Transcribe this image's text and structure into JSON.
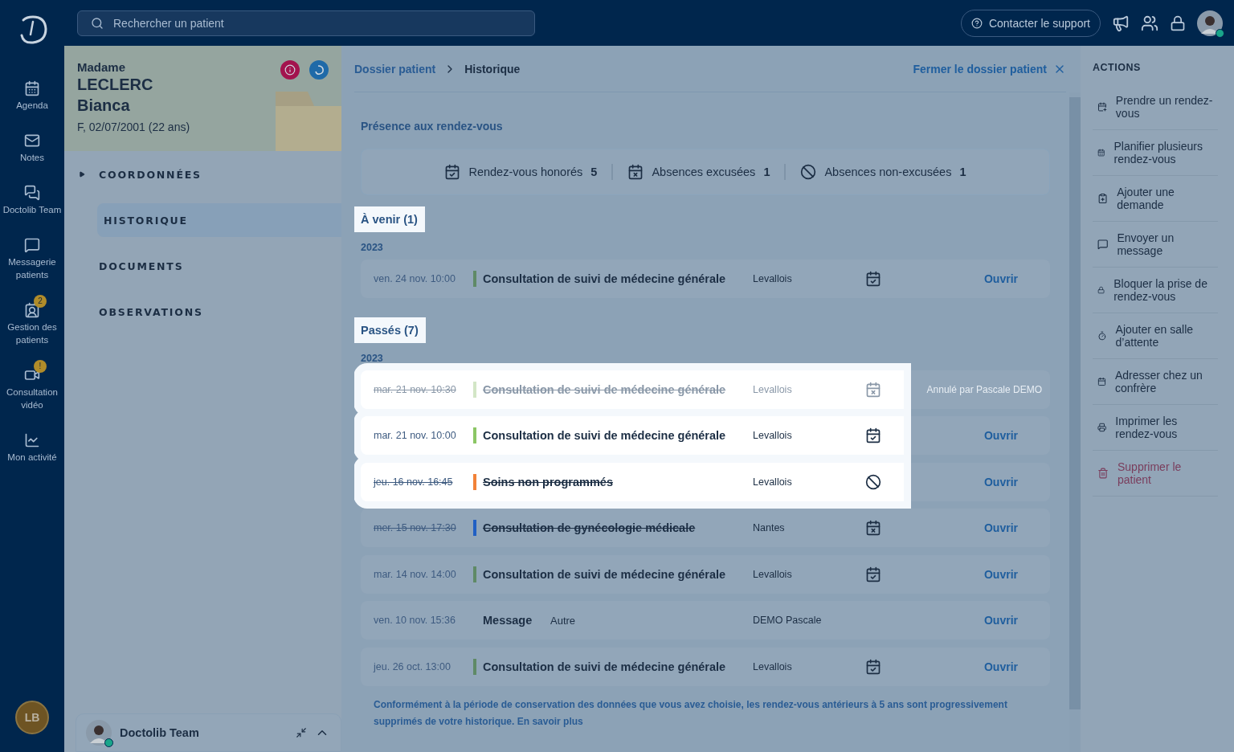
{
  "topbar": {
    "search_placeholder": "Rechercher un patient",
    "support": "Contacter le support"
  },
  "nav": [
    {
      "label": "Agenda"
    },
    {
      "label": "Notes"
    },
    {
      "label": "Doctolib Team"
    },
    {
      "label": "Messagerie patients"
    },
    {
      "label": "Gestion des patients",
      "badge": "2"
    },
    {
      "label": "Consultation vidéo",
      "badge": "!"
    },
    {
      "label": "Mon activité"
    }
  ],
  "user_initials": "LB",
  "patient": {
    "civility": "Madame",
    "last_name": "LECLERC",
    "first_name": "Bianca",
    "details": "F, 02/07/2001 (22 ans)"
  },
  "sections": [
    {
      "label": "COORDONNÉES",
      "expandable": true,
      "selected": false
    },
    {
      "label": "HISTORIQUE",
      "expandable": false,
      "selected": true
    },
    {
      "label": "DOCUMENTS",
      "expandable": false,
      "selected": false
    },
    {
      "label": "OBSERVATIONS",
      "expandable": false,
      "selected": false
    }
  ],
  "chat": {
    "title": "Doctolib Team"
  },
  "breadcrumb": [
    "Dossier patient",
    "Historique"
  ],
  "close_label": "Fermer le dossier patient",
  "attendance": {
    "title": "Présence aux rendez-vous",
    "stats": [
      {
        "kind": "honored",
        "label": "Rendez-vous honorés",
        "count": "5"
      },
      {
        "kind": "excused",
        "label": "Absences excusées",
        "count": "1"
      },
      {
        "kind": "unexcused",
        "label": "Absences non-excusées",
        "count": "1"
      }
    ]
  },
  "groups": [
    {
      "title": "À venir (1)",
      "highlighted": true,
      "year": "2023",
      "rows": [
        {
          "kind": "honored",
          "date": "ven. 24 nov. 10:00",
          "title": "Consultation de suivi de médecine générale",
          "place": "Levallois",
          "color": "#5f8a66",
          "struck": false,
          "cancelled": false,
          "highlighted": false,
          "action": "Ouvrir"
        }
      ]
    },
    {
      "title": "Passés (7)",
      "highlighted": true,
      "year": "2023",
      "rows": [
        {
          "kind": "excused",
          "date": "mar. 21 nov. 10:30",
          "title": "Consultation de suivi de médecine générale",
          "place": "Levallois",
          "color": "#d3e6c6",
          "struck": true,
          "cancelled": true,
          "highlighted": true,
          "note": "Annulé par Pascale DEMO"
        },
        {
          "kind": "honored",
          "date": "mar. 21 nov. 10:00",
          "title": "Consultation de suivi de médecine générale",
          "place": "Levallois",
          "color": "#8cc665",
          "struck": false,
          "cancelled": false,
          "highlighted": true,
          "action": "Ouvrir"
        },
        {
          "kind": "unexcused",
          "date": "jeu. 16 nov. 16:45",
          "title": "Soins non programmés",
          "place": "Levallois",
          "color": "#f28238",
          "struck": true,
          "cancelled": false,
          "highlighted": true,
          "action": "Ouvrir"
        },
        {
          "kind": "excused",
          "date": "mer. 15 nov. 17:30",
          "title": "Consultation de gynécologie médicale",
          "place": "Nantes",
          "color": "#2160c4",
          "struck": true,
          "cancelled": false,
          "highlighted": false,
          "action": "Ouvrir"
        },
        {
          "kind": "honored",
          "date": "mar. 14 nov. 14:00",
          "title": "Consultation de suivi de médecine générale",
          "place": "Levallois",
          "color": "#5f8a66",
          "struck": false,
          "cancelled": false,
          "highlighted": false,
          "action": "Ouvrir"
        },
        {
          "kind": "message",
          "date": "ven. 10 nov. 15:36",
          "title": "Message",
          "subtitle": "Autre",
          "place": "DEMO Pascale",
          "highlighted": false,
          "action": "Ouvrir"
        },
        {
          "kind": "honored",
          "date": "jeu. 26 oct. 13:00",
          "title": "Consultation de suivi de médecine générale",
          "place": "Levallois",
          "color": "#5f8a66",
          "struck": false,
          "cancelled": false,
          "highlighted": false,
          "action": "Ouvrir"
        }
      ]
    }
  ],
  "retention_note": {
    "text": "Conformément à la période de conservation des données que vous avez choisie, les rendez-vous antérieurs à 5 ans sont progressivement supprimés de votre historique.",
    "link": "En savoir plus"
  },
  "actions": {
    "title": "ACTIONS",
    "items": [
      {
        "label": "Prendre un rendez-vous",
        "disabled": false
      },
      {
        "label": "Planifier plusieurs rendez-vous",
        "disabled": false
      },
      {
        "label": "Ajouter une demande",
        "disabled": false
      },
      {
        "label": "Envoyer un message",
        "disabled": false
      },
      {
        "label": "Bloquer la prise de rendez-vous",
        "disabled": false
      },
      {
        "label": "Ajouter en salle d’attente",
        "disabled": false
      },
      {
        "label": "Adresser chez un confrère",
        "disabled": false
      },
      {
        "label": "Imprimer les rendez-vous",
        "disabled": false
      },
      {
        "label": "Supprimer le patient",
        "disabled": true
      }
    ]
  }
}
